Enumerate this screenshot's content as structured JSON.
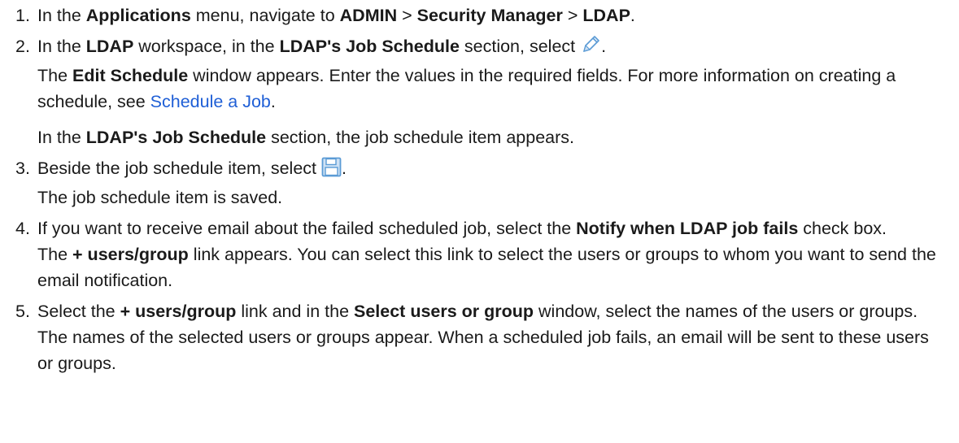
{
  "steps": [
    {
      "number": "1.",
      "line1": {
        "t1": "In the ",
        "b1": "Applications",
        "t2": " menu, navigate to ",
        "b2": "ADMIN",
        "t3": " > ",
        "b3": "Security Manager",
        "t4": " > ",
        "b4": "LDAP",
        "t5": "."
      }
    },
    {
      "number": "2.",
      "line1": {
        "t1": "In the ",
        "b1": "LDAP",
        "t2": " workspace, in the ",
        "b2": "LDAP's Job Schedule",
        "t3": " section, select ",
        "t4": ".",
        "icon": "pencil-edit-icon"
      },
      "result": {
        "t1": "The ",
        "b1": "Edit Schedule",
        "t2": " window appears. Enter the values in the required fields. For more information on creating a schedule, see ",
        "link": "Schedule a Job",
        "t3": "."
      },
      "note": {
        "t1": "In the ",
        "b1": "LDAP's Job Schedule",
        "t2": " section, the job schedule item appears."
      }
    },
    {
      "number": "3.",
      "line1": {
        "t1": "Beside the job schedule item, select ",
        "t2": ".",
        "icon": "save-floppy-icon"
      },
      "result": "The job schedule item is saved."
    },
    {
      "number": "4.",
      "line1": {
        "t1": "If you want to receive email about the failed scheduled job, select the ",
        "b1": "Notify when LDAP job fails",
        "t2": " check box."
      },
      "result": {
        "t1": "The ",
        "b1": "+ users/group",
        "t2": " link appears. You can select this link to select the users or groups to whom you want to send the email notification."
      }
    },
    {
      "number": "5.",
      "line1": {
        "t1": "Select the ",
        "b1": "+ users/group",
        "t2": " link and in the ",
        "b2": "Select users or group",
        "t3": " window, select the names of the users or groups."
      },
      "result": "The names of the selected users or groups appear. When a scheduled job fails, an email will be sent to these users or groups."
    }
  ],
  "colors": {
    "text": "#1a1a1a",
    "link": "#1f5fd6",
    "icon_blue": "#5b9bd5"
  }
}
